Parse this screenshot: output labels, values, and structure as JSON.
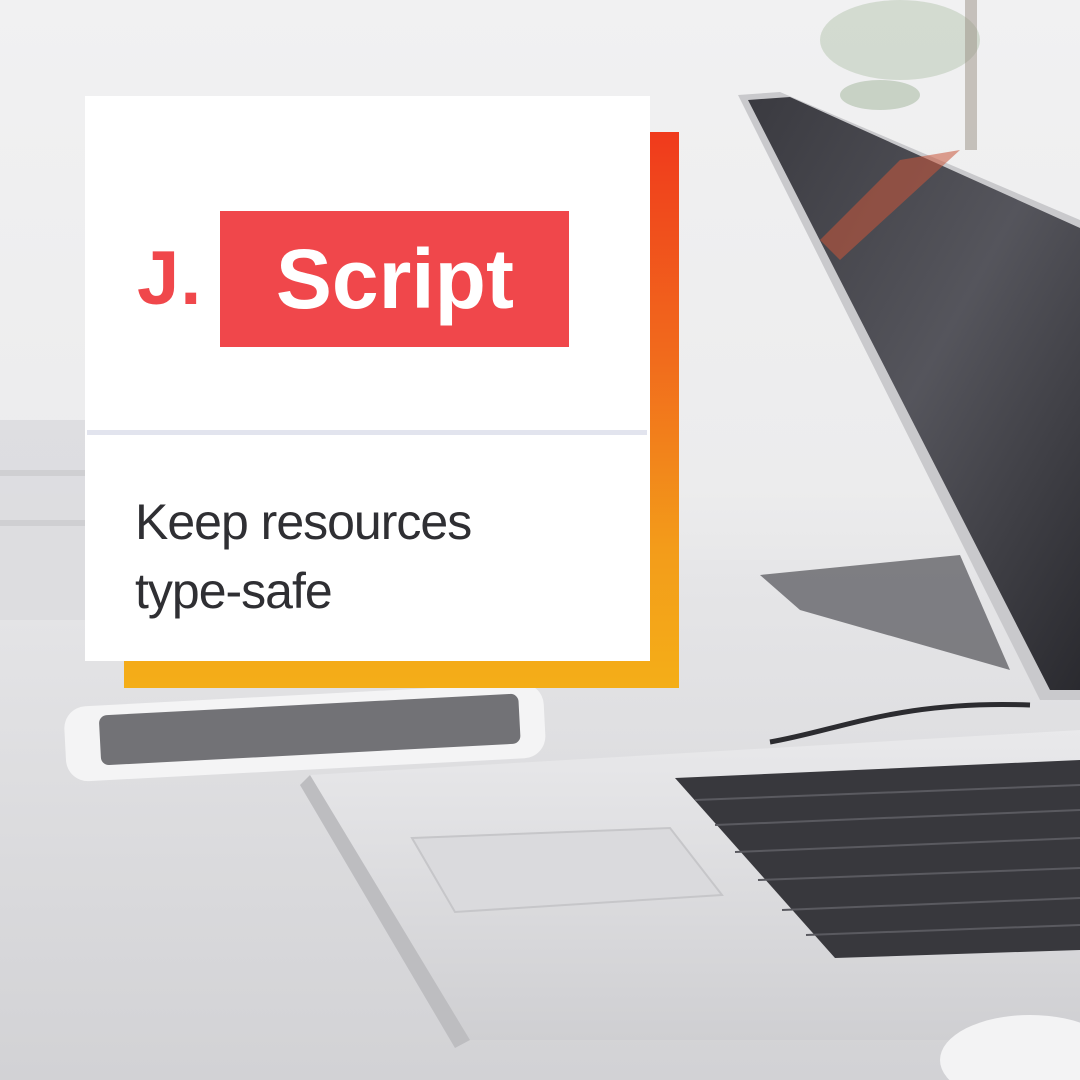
{
  "brand": {
    "prefix": "J.",
    "name": "Script"
  },
  "tagline": {
    "line1": "Keep resources",
    "line2": "type-safe"
  },
  "colors": {
    "brand_red": "#f0474b",
    "accent_gradient_top": "#f03a1c",
    "accent_gradient_bottom": "#f4ae18",
    "divider": "#e2e4ee",
    "card": "#ffffff"
  },
  "background": {
    "icon": "laptop-desk-photo"
  }
}
